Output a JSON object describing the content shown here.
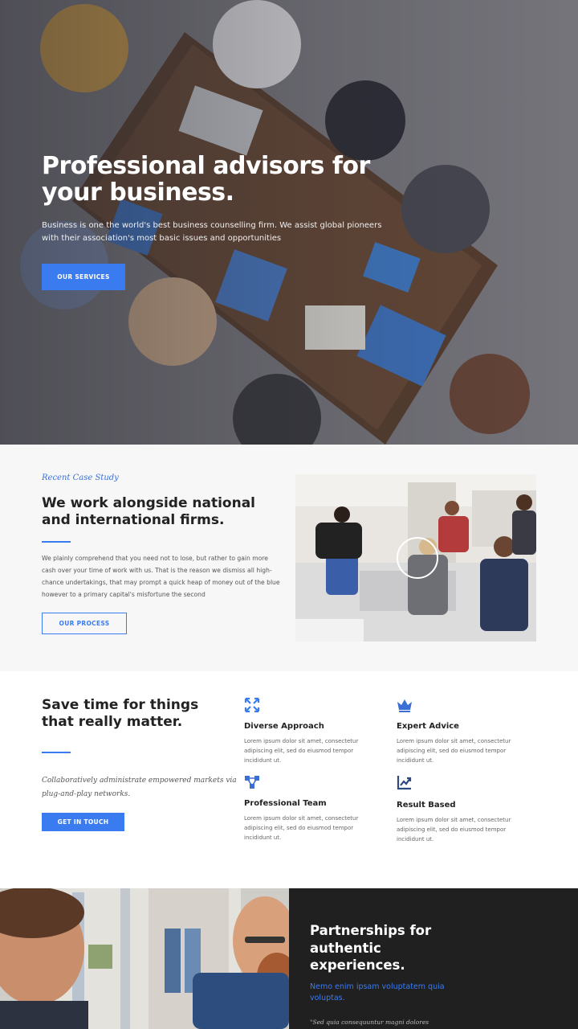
{
  "hero": {
    "title": "Professional advisors for your business.",
    "text": "Business is one the world's best business counselling firm. We assist global pioneers with their association's most basic issues and opportunities",
    "button": "OUR SERVICES"
  },
  "case_study": {
    "eyebrow": "Recent Case Study",
    "title": "We work alongside national and international firms.",
    "text": "We plainly comprehend that you need not to lose, but rather to gain more cash over your time of work with us. That is the reason we dismiss all high-chance undertakings, that may prompt a quick heap of money out of the blue however to a primary capital's misfortune the second",
    "button": "OUR PROCESS"
  },
  "save": {
    "title": "Save time for things that really matter.",
    "quote": "Collaboratively administrate empowered markets via plug-and-play networks.",
    "button": "GET IN TOUCH",
    "features": [
      {
        "icon": "arrows-icon",
        "title": "Diverse Approach",
        "text": "Lorem ipsum dolor sit amet, consectetur adipiscing elit, sed do eiusmod tempor incididunt ut."
      },
      {
        "icon": "crown-icon",
        "title": "Expert Advice",
        "text": "Lorem ipsum dolor sit amet, consectetur adipiscing elit, sed do eiusmod tempor incididunt ut."
      },
      {
        "icon": "network-icon",
        "title": "Professional Team",
        "text": "Lorem ipsum dolor sit amet, consectetur adipiscing elit, sed do eiusmod tempor incididunt ut."
      },
      {
        "icon": "chart-icon",
        "title": "Result Based",
        "text": "Lorem ipsum dolor sit amet, consectetur adipiscing elit, sed do eiusmod tempor incididunt ut."
      }
    ]
  },
  "partnership": {
    "title": "Partnerships for authentic experiences.",
    "subtitle": "Nemo enim ipsam voluptatem quia voluptas.",
    "quote": "\"Sed quia consequuntur magni dolores"
  },
  "colors": {
    "accent": "#3b7bf0",
    "dark": "#202020",
    "light_bg": "#f7f7f7"
  }
}
